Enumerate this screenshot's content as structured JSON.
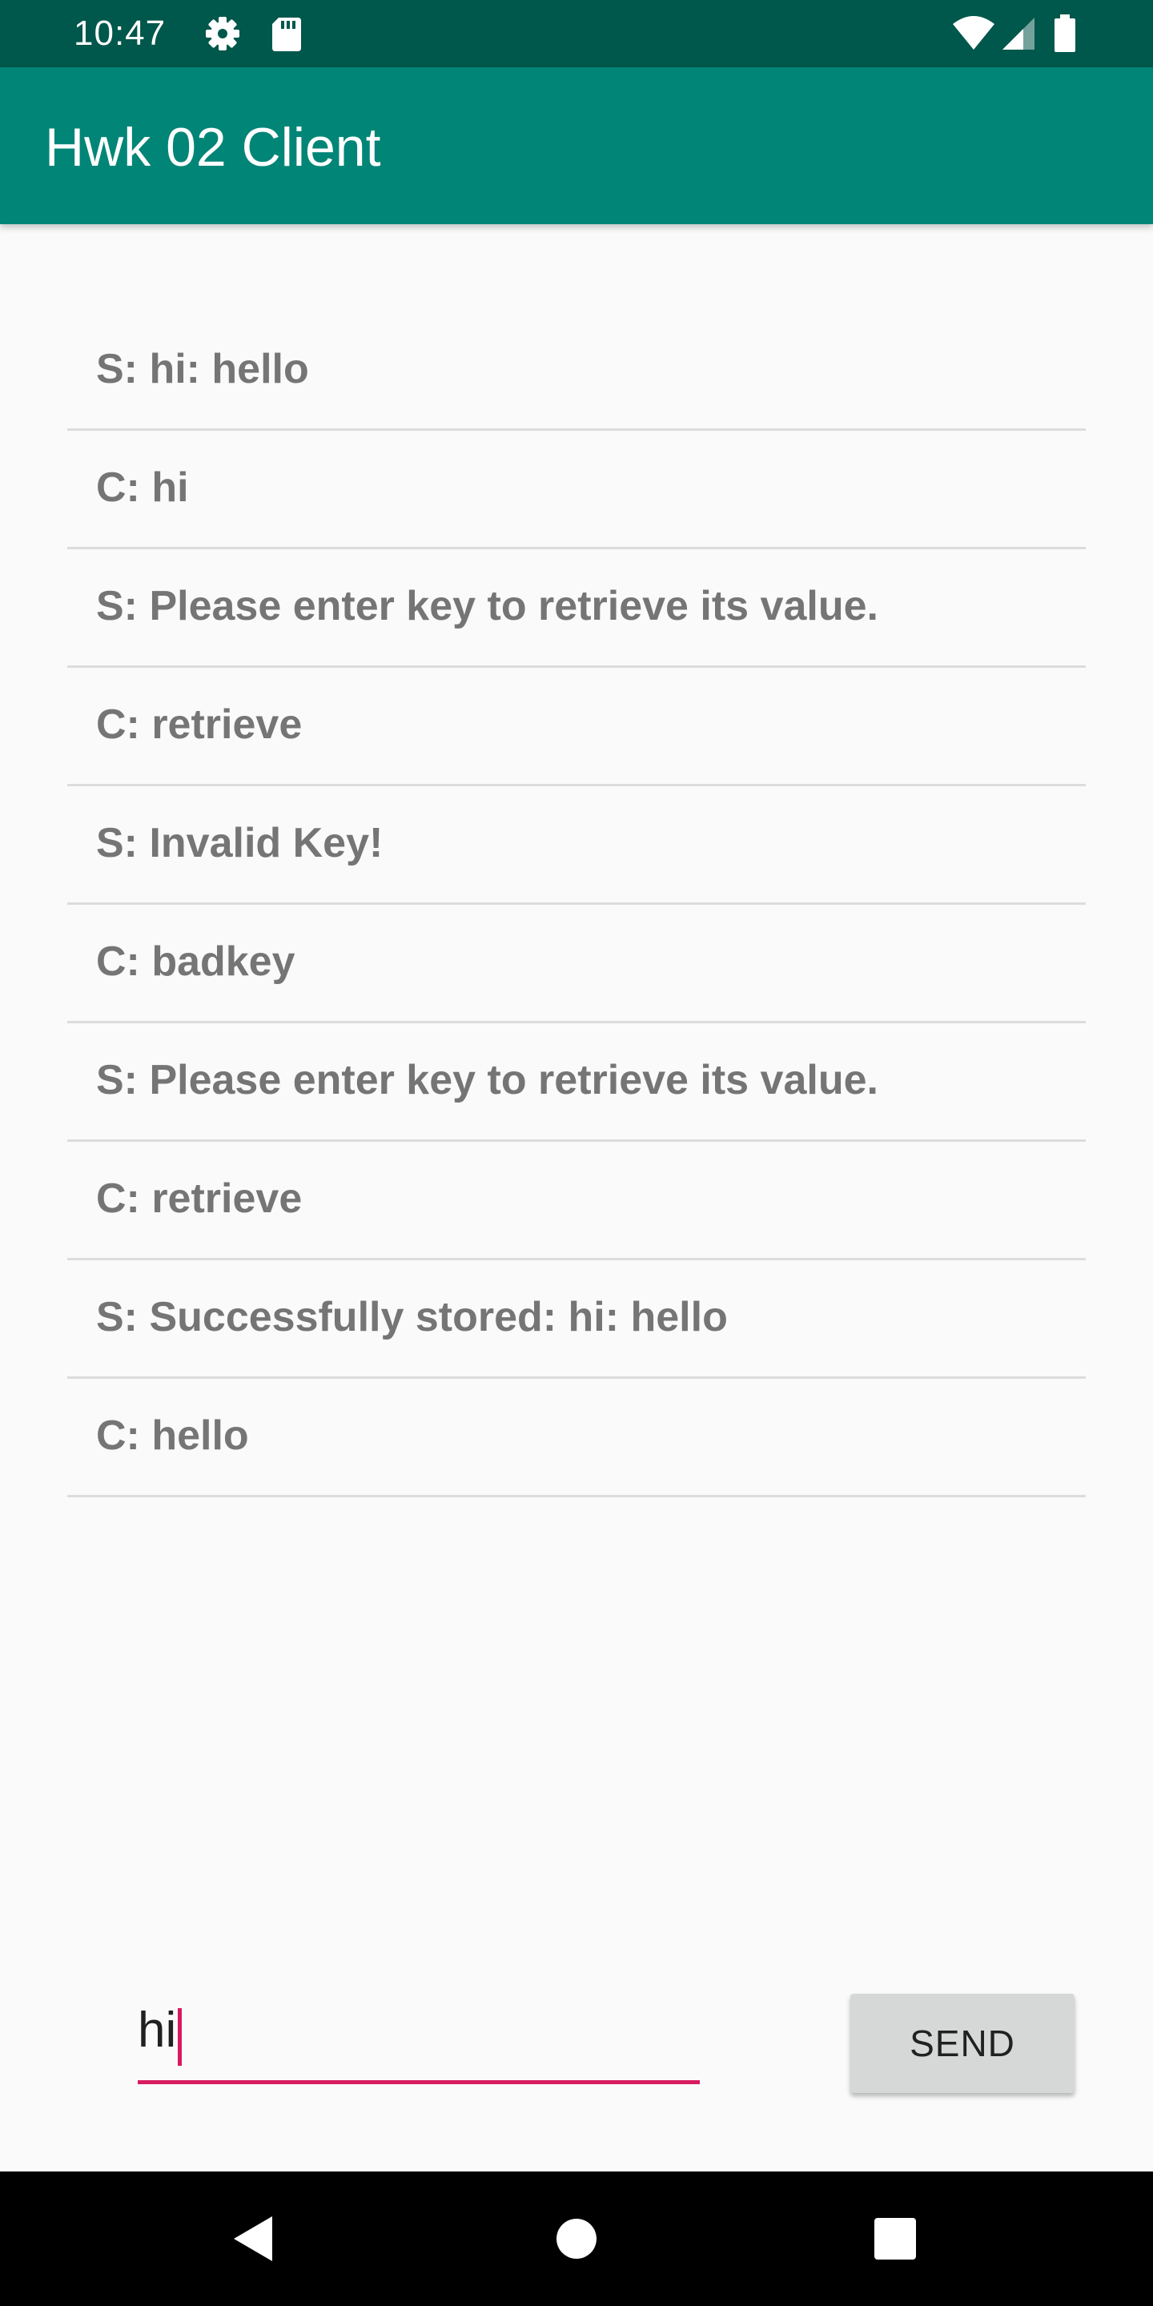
{
  "status_bar": {
    "time": "10:47",
    "icons": [
      "gear-icon",
      "sd-card-icon",
      "wifi-icon",
      "signal-icon",
      "battery-icon"
    ],
    "background_color": "#00574b"
  },
  "app_bar": {
    "title": "Hwk 02 Client",
    "background_color": "#008577"
  },
  "messages": [
    "S: hi: hello",
    "C: hi",
    "S: Please enter key to retrieve its value.",
    "C: retrieve",
    "S: Invalid Key!",
    "C: badkey",
    "S: Please enter key to retrieve its value.",
    "C: retrieve",
    "S: Successfully stored: hi: hello",
    "C: hello"
  ],
  "composer": {
    "input_value": "hi",
    "send_label": "SEND",
    "accent_color": "#d81b60"
  },
  "navigation_bar": {
    "buttons": [
      "back-icon",
      "home-icon",
      "recents-icon"
    ]
  }
}
